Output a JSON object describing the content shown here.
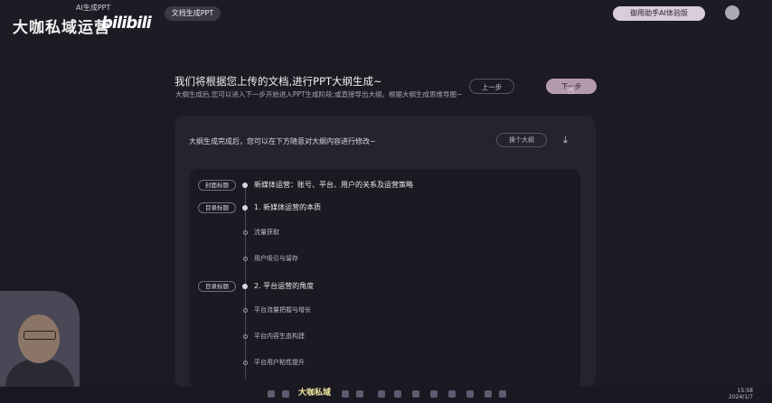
{
  "header": {
    "brand": "大咖私域运营",
    "bili": "bilibili",
    "ai_tag": "AI生成PPT",
    "tab": "文档生成PPT",
    "right_button": "御用助手AI体验版",
    "avatar_icon": "avatar-icon"
  },
  "main": {
    "title": "我们将根据您上传的文档,进行PPT大纲生成~",
    "subtitle": "大纲生成后,您可以进入下一步开始进入PPT生成阶段;或直接导出大纲。根据大纲生成思维导图~",
    "prev_button": "上一步",
    "next_button": "下一步",
    "cursor_icon": "cursor-icon"
  },
  "card": {
    "hint": "大纲生成完成后，您可以在下方随意对大纲内容进行修改~",
    "change_button": "换个大纲",
    "download_icon": "download-icon"
  },
  "outline": {
    "cover_tag": "封面标题",
    "cover_text": "新媒体运营：账号、平台、用户的关系及运营策略",
    "sections": [
      {
        "tag": "目录标题",
        "title": "1. 新媒体运营的本质",
        "items": [
          "流量获取",
          "用户吸引与留存"
        ]
      },
      {
        "tag": "目录标题",
        "title": "2. 平台运营的角度",
        "items": [
          "平台流量把握与增长",
          "平台内容生态构建",
          "平台用户粘性提升"
        ]
      }
    ]
  },
  "taskbar": {
    "time": "15:58",
    "date": "2024/1/7",
    "logo": "大咖私域"
  },
  "colors": {
    "background": "#1c1b24",
    "card": "#24232e",
    "accent": "#b49aae"
  }
}
